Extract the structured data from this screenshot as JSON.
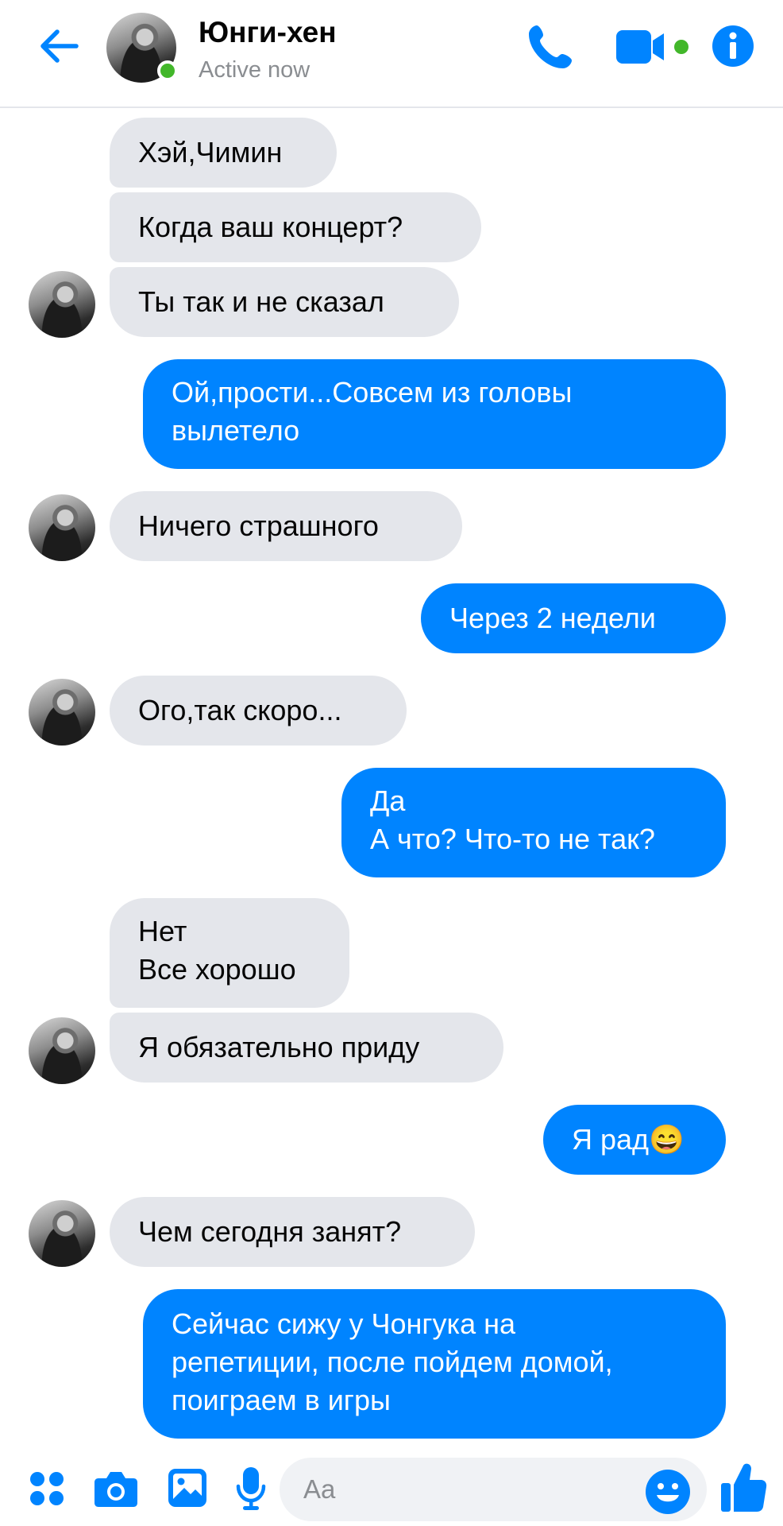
{
  "header": {
    "contact_name": "Юнги-хен",
    "status": "Active now"
  },
  "messages": [
    {
      "side": "in",
      "text": "Хэй,Чимин"
    },
    {
      "side": "in",
      "text": "Когда ваш концерт?"
    },
    {
      "side": "in",
      "text": "Ты так и не сказал"
    },
    {
      "side": "out",
      "text": "Ой,прости...Совсем из головы\nвылетело"
    },
    {
      "side": "in",
      "text": "Ничего страшного"
    },
    {
      "side": "out",
      "text": "Через 2 недели"
    },
    {
      "side": "in",
      "text": "Ого,так скоро..."
    },
    {
      "side": "out",
      "text": "Да\nА что? Что-то не так?"
    },
    {
      "side": "in",
      "text": "Нет\nВсе хорошо"
    },
    {
      "side": "in",
      "text": "Я обязательно приду"
    },
    {
      "side": "out",
      "text": "Я рад😄"
    },
    {
      "side": "in",
      "text": "Чем сегодня занят?"
    },
    {
      "side": "out",
      "text": "Сейчас сижу у Чонгука на\nрепетиции, после пойдем домой,\nпоиграем в игры"
    }
  ],
  "composer": {
    "placeholder": "Aa"
  },
  "colors": {
    "accent": "#0084ff",
    "incoming_bubble": "#e4e6eb",
    "online": "#42b72a"
  },
  "icons": [
    "back-arrow-icon",
    "phone-icon",
    "video-camera-icon",
    "info-icon",
    "apps-grid-icon",
    "camera-icon",
    "gallery-icon",
    "microphone-icon",
    "emoji-icon",
    "thumbs-up-icon"
  ]
}
